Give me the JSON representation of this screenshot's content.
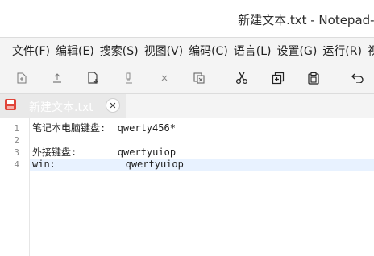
{
  "window": {
    "title": "新建文本.txt - Notepad--"
  },
  "menu": {
    "items": [
      "文件(F)",
      "编辑(E)",
      "搜索(S)",
      "视图(V)",
      "编码(C)",
      "语言(L)",
      "设置(G)",
      "运行(R)",
      "视图"
    ]
  },
  "toolbar": {
    "icons": [
      "new-file-icon",
      "open-file-icon",
      "save-file-icon",
      "save-all-icon",
      "close-file-icon",
      "close-all-icon",
      "cut-icon",
      "copy-icon",
      "paste-icon",
      "undo-icon"
    ]
  },
  "tab": {
    "name": "新建文本.txt",
    "close_glyph": "✕",
    "unsaved_color": "#e0453a"
  },
  "editor": {
    "line_numbers": [
      "1",
      "2",
      "3",
      "4"
    ],
    "lines": [
      "笔记本电脑键盘:  qwerty456*",
      "",
      "外接键盘:       qwertyuiop",
      "win:            qwertyuiop"
    ],
    "active_line": 4
  }
}
